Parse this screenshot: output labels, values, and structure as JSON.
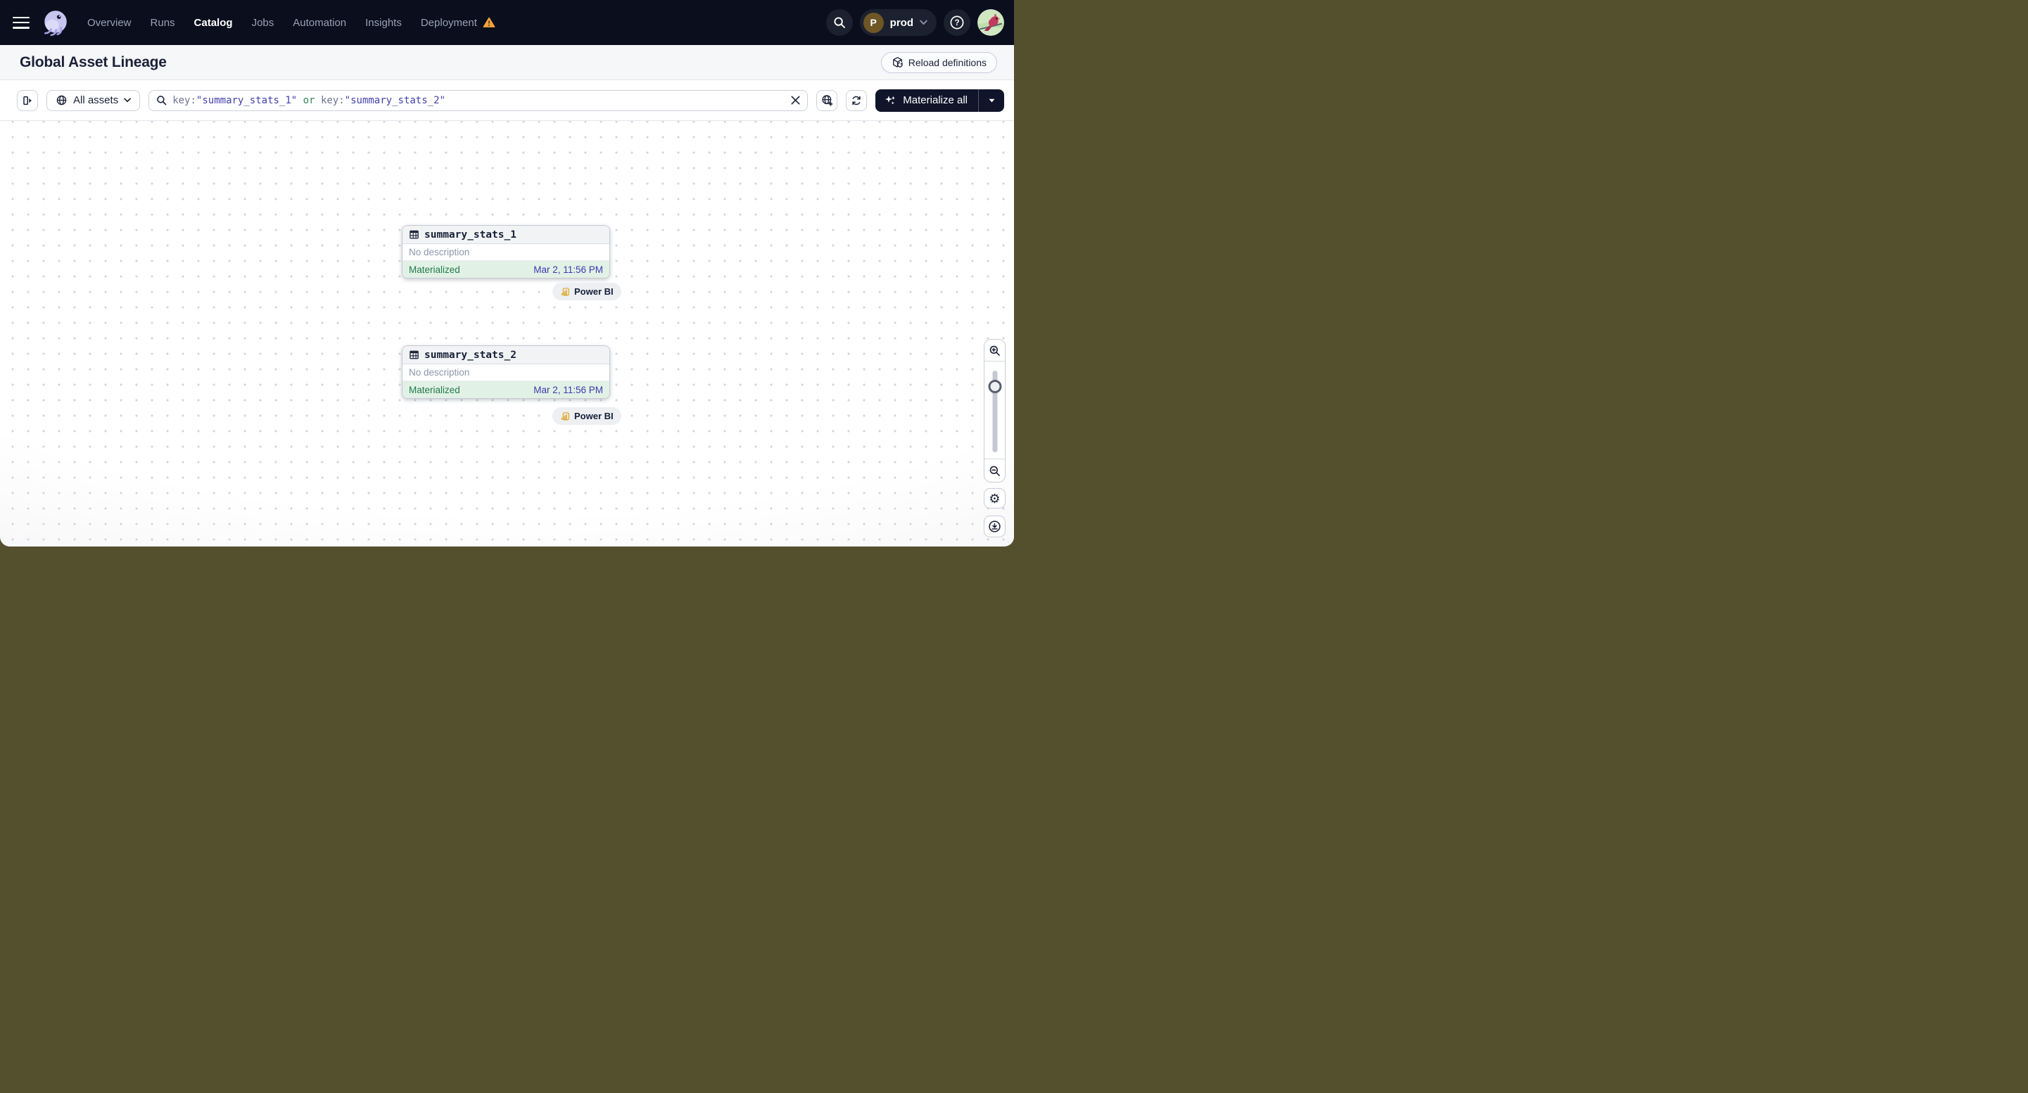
{
  "nav": {
    "items": [
      {
        "label": "Overview"
      },
      {
        "label": "Runs"
      },
      {
        "label": "Catalog"
      },
      {
        "label": "Jobs"
      },
      {
        "label": "Automation"
      },
      {
        "label": "Insights"
      },
      {
        "label": "Deployment"
      }
    ],
    "active_item": "Catalog",
    "deployment_switcher": {
      "initial": "P",
      "label": "prod"
    }
  },
  "page": {
    "title": "Global Asset Lineage",
    "reload_button": "Reload definitions"
  },
  "toolbar": {
    "scope_button": "All assets",
    "query": {
      "key1": "key:",
      "value1": "\"summary_stats_1\"",
      "operator": " or ",
      "key2": "key:",
      "value2": "\"summary_stats_2\""
    },
    "materialize_button": "Materialize all"
  },
  "graph": {
    "nodes": [
      {
        "name": "summary_stats_1",
        "description": "No description",
        "status": "Materialized",
        "materialized_at": "Mar 2, 11:56 PM",
        "tag": "Power BI"
      },
      {
        "name": "summary_stats_2",
        "description": "No description",
        "status": "Materialized",
        "materialized_at": "Mar 2, 11:56 PM",
        "tag": "Power BI"
      }
    ]
  },
  "colors": {
    "nav_bg": "#0a0e1d",
    "status_green_bg": "#e1f1e6",
    "status_green_text": "#217a4b",
    "timestamp_indigo": "#3c39ad",
    "query_value_indigo": "#4342ab",
    "query_operator_green": "#35845a",
    "warning_orange": "#f0a23c",
    "materialize_bg": "#10152b",
    "powerbi_gold": "#dca722"
  }
}
